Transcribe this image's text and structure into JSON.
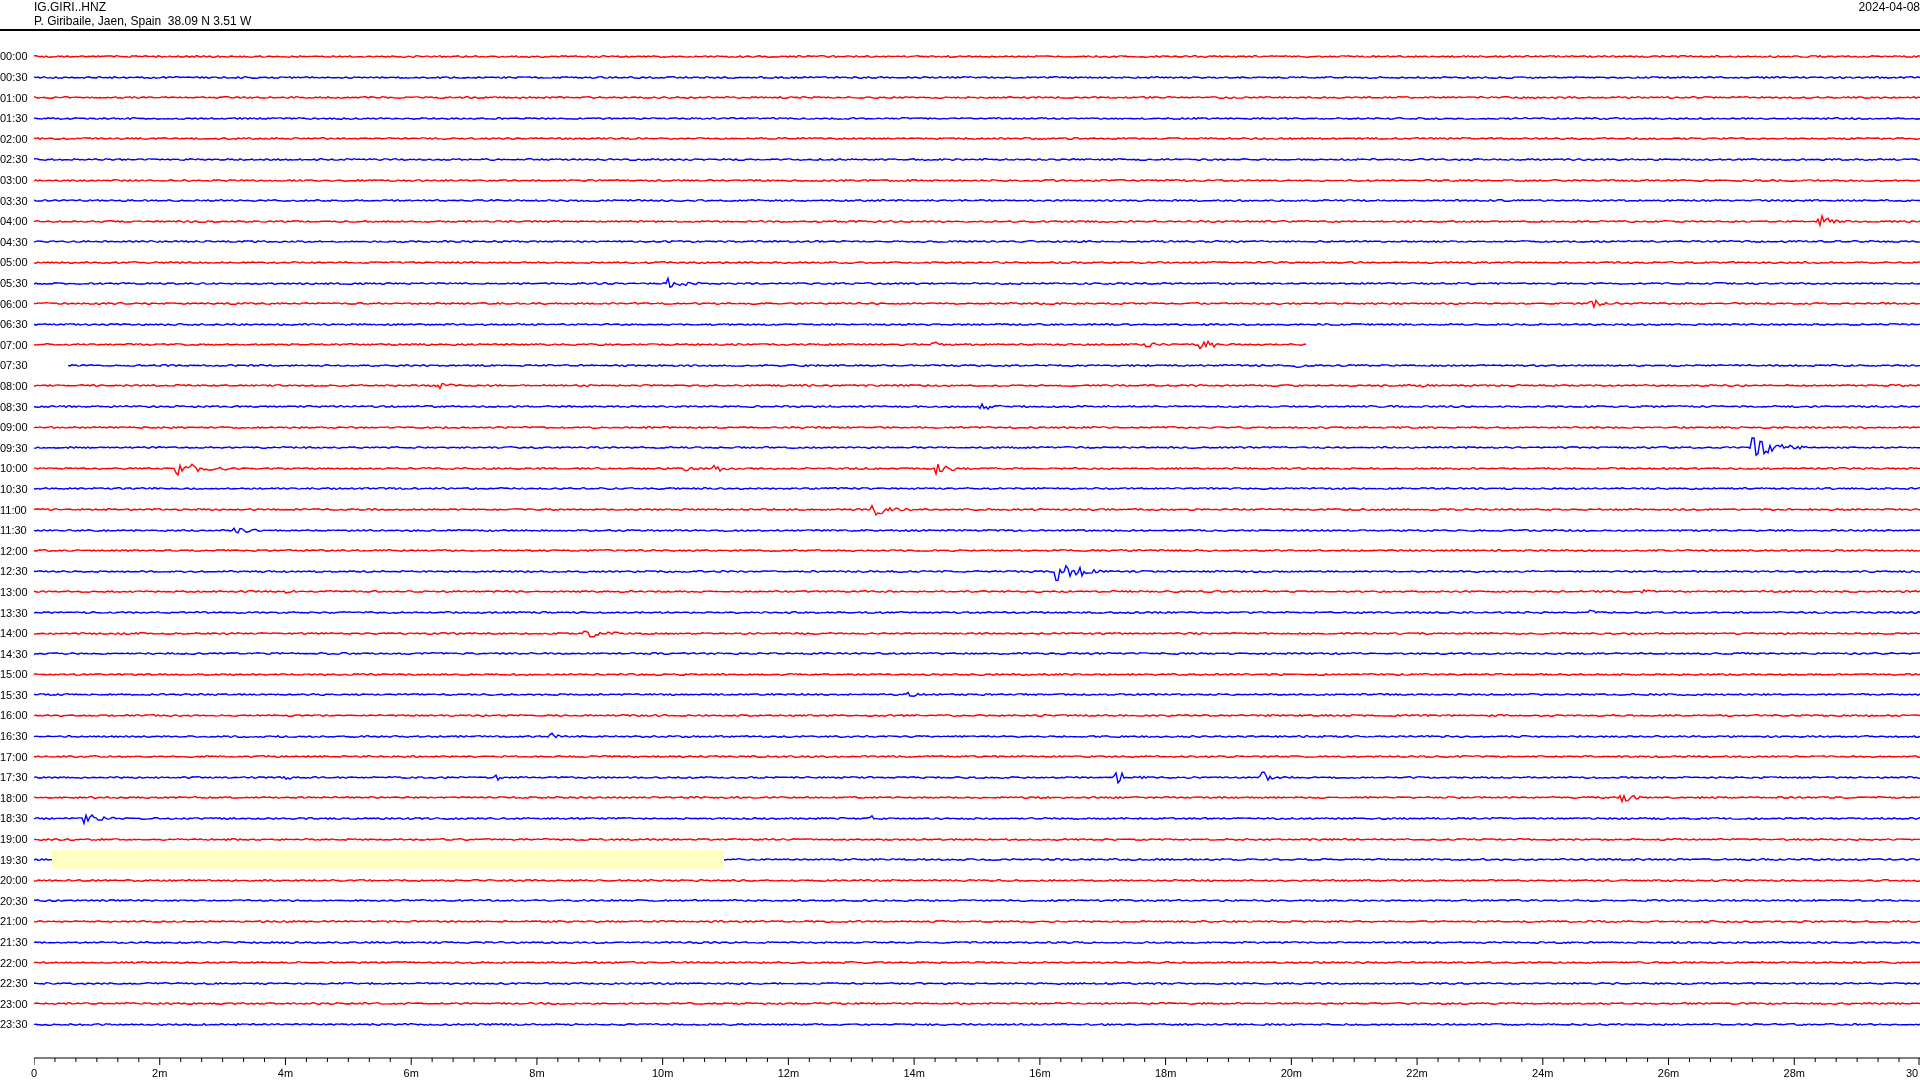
{
  "header": {
    "station": "IG.GIRI..HNZ",
    "location": "P. Giribaile, Jaen, Spain  38.09 N 3.51 W",
    "date": "2024-04-08"
  },
  "rows": [
    {
      "time": "00:00",
      "color": "#ff0000"
    },
    {
      "time": "00:30",
      "color": "#0000ff"
    },
    {
      "time": "01:00",
      "color": "#ff0000"
    },
    {
      "time": "01:30",
      "color": "#0000ff"
    },
    {
      "time": "02:00",
      "color": "#ff0000"
    },
    {
      "time": "02:30",
      "color": "#0000ff"
    },
    {
      "time": "03:00",
      "color": "#ff0000"
    },
    {
      "time": "03:30",
      "color": "#0000ff"
    },
    {
      "time": "04:00",
      "color": "#ff0000"
    },
    {
      "time": "04:30",
      "color": "#0000ff"
    },
    {
      "time": "05:00",
      "color": "#ff0000"
    },
    {
      "time": "05:30",
      "color": "#0000ff"
    },
    {
      "time": "06:00",
      "color": "#ff0000"
    },
    {
      "time": "06:30",
      "color": "#0000ff"
    },
    {
      "time": "07:00",
      "color": "#ff0000"
    },
    {
      "time": "07:30",
      "color": "#0000ff"
    },
    {
      "time": "08:00",
      "color": "#ff0000"
    },
    {
      "time": "08:30",
      "color": "#0000ff"
    },
    {
      "time": "09:00",
      "color": "#ff0000"
    },
    {
      "time": "09:30",
      "color": "#0000ff"
    },
    {
      "time": "10:00",
      "color": "#ff0000"
    },
    {
      "time": "10:30",
      "color": "#0000ff"
    },
    {
      "time": "11:00",
      "color": "#ff0000"
    },
    {
      "time": "11:30",
      "color": "#0000ff"
    },
    {
      "time": "12:00",
      "color": "#ff0000"
    },
    {
      "time": "12:30",
      "color": "#0000ff"
    },
    {
      "time": "13:00",
      "color": "#ff0000"
    },
    {
      "time": "13:30",
      "color": "#0000ff"
    },
    {
      "time": "14:00",
      "color": "#ff0000"
    },
    {
      "time": "14:30",
      "color": "#0000ff"
    },
    {
      "time": "15:00",
      "color": "#ff0000"
    },
    {
      "time": "15:30",
      "color": "#0000ff"
    },
    {
      "time": "16:00",
      "color": "#ff0000"
    },
    {
      "time": "16:30",
      "color": "#0000ff"
    },
    {
      "time": "17:00",
      "color": "#ff0000"
    },
    {
      "time": "17:30",
      "color": "#0000ff"
    },
    {
      "time": "18:00",
      "color": "#ff0000"
    },
    {
      "time": "18:30",
      "color": "#0000ff"
    },
    {
      "time": "19:00",
      "color": "#ff0000"
    },
    {
      "time": "19:30",
      "color": "#0000ff"
    },
    {
      "time": "20:00",
      "color": "#ff0000"
    },
    {
      "time": "20:30",
      "color": "#0000ff"
    },
    {
      "time": "21:00",
      "color": "#ff0000"
    },
    {
      "time": "21:30",
      "color": "#0000ff"
    },
    {
      "time": "22:00",
      "color": "#ff0000"
    },
    {
      "time": "22:30",
      "color": "#0000ff"
    },
    {
      "time": "23:00",
      "color": "#ff0000"
    },
    {
      "time": "23:30",
      "color": "#0000ff"
    }
  ],
  "axis": {
    "labels": [
      "0",
      "2m",
      "4m",
      "6m",
      "8m",
      "10m",
      "12m",
      "14m",
      "16m",
      "18m",
      "20m",
      "22m",
      "24m",
      "26m",
      "28m",
      "30"
    ]
  }
}
